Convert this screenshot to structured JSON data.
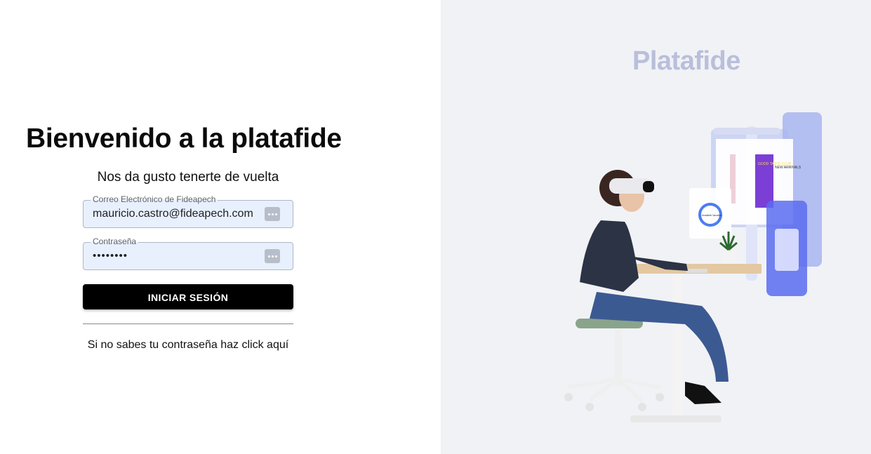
{
  "login": {
    "title": "Bienvenido a la platafide",
    "subtitle": "Nos da gusto tenerte de vuelta",
    "email": {
      "label": "Correo Electrónico de Fideapech",
      "value": "mauricio.castro@fideapech.com"
    },
    "password": {
      "label": "Contraseña",
      "value": "••••••••"
    },
    "submit_label": "INICIAR SESIÓN",
    "forgot_text": "Si no sabes tu contraseña haz click aquí"
  },
  "brand": {
    "name": "Platafide"
  },
  "illustration": {
    "screen_text_1": "GOOD TASTE CLUB",
    "screen_text_2": "NEW ARRIVALS",
    "widget_text": "Available Vacation"
  },
  "colors": {
    "panel_bg": "#f1f2f6",
    "brand": "#b9bfdb",
    "field_bg": "#e8f0fe",
    "button": "#000000"
  }
}
